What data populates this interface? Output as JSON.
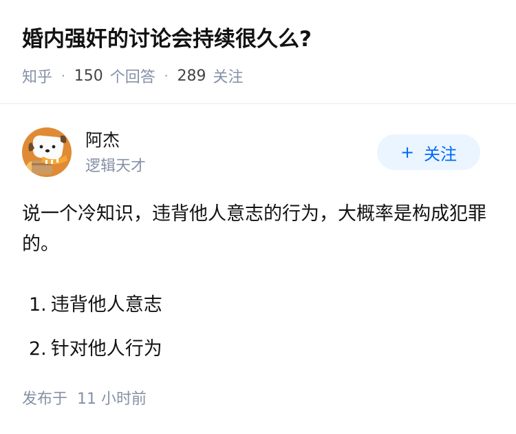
{
  "question": {
    "title": "婚内强奸的讨论会持续很久么?",
    "source": "知乎",
    "separator": "·",
    "answer_count": "150",
    "answer_label": "个回答",
    "follower_count": "289",
    "follower_label": "关注"
  },
  "author": {
    "name": "阿杰",
    "bio": "逻辑天才",
    "avatar_icon": "dog-avatar-icon",
    "follow_plus": "+",
    "follow_label": "关注"
  },
  "answer": {
    "paragraph": "说一个冷知识，违背他人意志的行为，大概率是构成犯罪的。",
    "list": [
      {
        "index": "1.",
        "text": "违背他人意志"
      },
      {
        "index": "2.",
        "text": "针对他人行为"
      }
    ],
    "posted_label": "发布于",
    "posted_time": "11 小时前"
  },
  "colors": {
    "title": "#121212",
    "meta": "#8590a6",
    "accent": "#0066ff",
    "follow_bg": "#ebf5ff",
    "divider": "#ebebeb"
  }
}
